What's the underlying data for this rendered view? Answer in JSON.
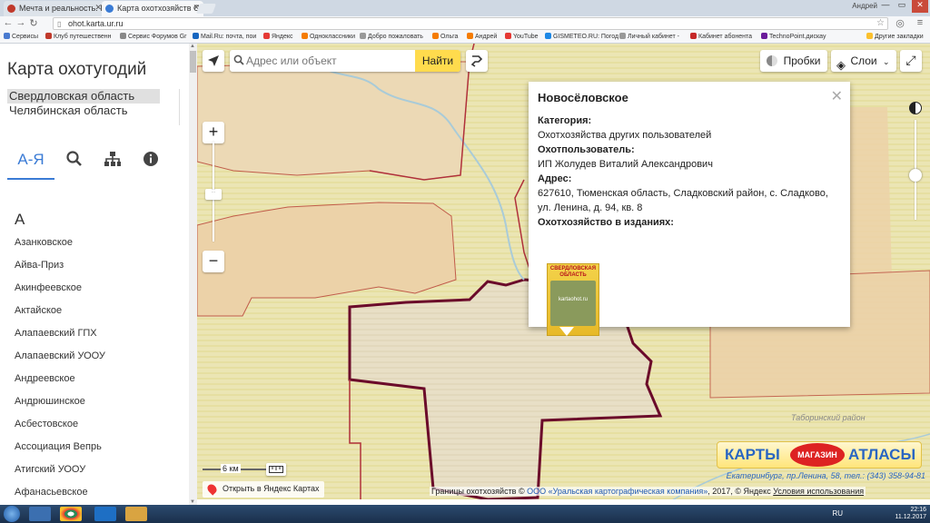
{
  "browser": {
    "tabs": [
      {
        "title": "Мечта и реальность. П..."
      },
      {
        "title": "Карта охотхозяйств Све..."
      }
    ],
    "user": "Андрей",
    "url": "ohot.karta.ur.ru",
    "bookmarks": [
      "Сервисы",
      "Клуб путешественн",
      "Сервис Форумов Gr",
      "Mail.Ru: почта, пои",
      "Яндекс",
      "Одноклассники",
      "Добро пожаловать",
      "Ольга",
      "Андрей",
      "YouTube",
      "GISMETEO.RU: Погод",
      "Личный кабинет -",
      "Кабинет абонента",
      "TechnoPoint.дискау",
      "Другие закладки"
    ]
  },
  "panel": {
    "title": "Карта охотугодий",
    "regions": [
      "Свердловская область",
      "Челябинская область"
    ],
    "tabs": [
      "А-Я",
      "search-icon",
      "hierarchy-icon",
      "info-icon"
    ],
    "letter": "А",
    "items": [
      "Азанковское",
      "Айва-Приз",
      "Акинфеевское",
      "Актайское",
      "Алапаевский ГПХ",
      "Алапаевский УООУ",
      "Андреевское",
      "Андрюшинское",
      "Асбестовское",
      "Ассоциация Вепрь",
      "Атигский УООУ",
      "Афанасьевское"
    ]
  },
  "map": {
    "search_placeholder": "Адрес или объект",
    "find_label": "Найти",
    "traffic_label": "Пробки",
    "layers_label": "Слои",
    "zoom_in": "+",
    "zoom_out": "−",
    "scale": "6 км",
    "open_yandex": "Открыть в Яндекс Картах",
    "label_tobolsk": "Таборинский район",
    "copyright": {
      "prefix": "Границы охотхозяйств © ",
      "company": "ООО «Уральская картографическая компания»",
      "suffix": ", 2017, © Яндекс ",
      "terms": "Условия использования"
    },
    "popup": {
      "title": "Новосёловское",
      "category_label": "Категория:",
      "category": "Охотхозяйства других пользователей",
      "user_label": "Охотпользователь:",
      "user": "ИП Жолудев Виталий Александрович",
      "address_label": "Адрес:",
      "address_line1": "627610, Тюменская область, Сладковский район, с. Сладково,",
      "address_line2": "ул. Ленина, д. 94, кв. 8",
      "editions_label": "Охотхозяйство в изданиях:",
      "book_title": "СВЕРДЛОВСКАЯ ОБЛАСТЬ",
      "book_caption": "kartaohot.ru"
    },
    "ad": {
      "word1": "КАРТЫ",
      "word_mid": "МАГАЗИН",
      "word2": "АТЛАСЫ",
      "address": "Екатеринбург, пр.Ленина, 58, тел.: (343) 358-94-81"
    }
  },
  "taskbar": {
    "lang": "RU",
    "time": "22:16",
    "date": "11.12.2017"
  },
  "colors": {
    "accent": "#3a7bd5",
    "find_button": "#ffdb4d",
    "boundary_dark": "#6b0a2a",
    "boundary": "#b0313b"
  }
}
